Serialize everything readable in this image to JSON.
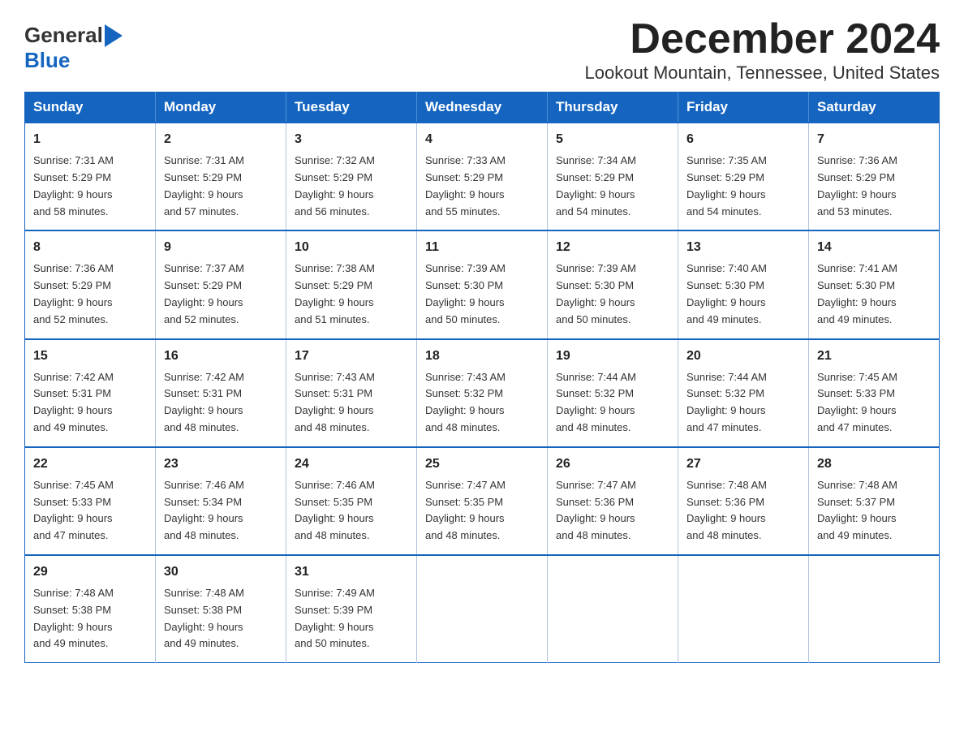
{
  "header": {
    "logo_general": "General",
    "logo_blue": "Blue",
    "title": "December 2024",
    "subtitle": "Lookout Mountain, Tennessee, United States"
  },
  "days_of_week": [
    "Sunday",
    "Monday",
    "Tuesday",
    "Wednesday",
    "Thursday",
    "Friday",
    "Saturday"
  ],
  "weeks": [
    [
      {
        "day": "1",
        "sunrise": "7:31 AM",
        "sunset": "5:29 PM",
        "daylight": "9 hours and 58 minutes."
      },
      {
        "day": "2",
        "sunrise": "7:31 AM",
        "sunset": "5:29 PM",
        "daylight": "9 hours and 57 minutes."
      },
      {
        "day": "3",
        "sunrise": "7:32 AM",
        "sunset": "5:29 PM",
        "daylight": "9 hours and 56 minutes."
      },
      {
        "day": "4",
        "sunrise": "7:33 AM",
        "sunset": "5:29 PM",
        "daylight": "9 hours and 55 minutes."
      },
      {
        "day": "5",
        "sunrise": "7:34 AM",
        "sunset": "5:29 PM",
        "daylight": "9 hours and 54 minutes."
      },
      {
        "day": "6",
        "sunrise": "7:35 AM",
        "sunset": "5:29 PM",
        "daylight": "9 hours and 54 minutes."
      },
      {
        "day": "7",
        "sunrise": "7:36 AM",
        "sunset": "5:29 PM",
        "daylight": "9 hours and 53 minutes."
      }
    ],
    [
      {
        "day": "8",
        "sunrise": "7:36 AM",
        "sunset": "5:29 PM",
        "daylight": "9 hours and 52 minutes."
      },
      {
        "day": "9",
        "sunrise": "7:37 AM",
        "sunset": "5:29 PM",
        "daylight": "9 hours and 52 minutes."
      },
      {
        "day": "10",
        "sunrise": "7:38 AM",
        "sunset": "5:29 PM",
        "daylight": "9 hours and 51 minutes."
      },
      {
        "day": "11",
        "sunrise": "7:39 AM",
        "sunset": "5:30 PM",
        "daylight": "9 hours and 50 minutes."
      },
      {
        "day": "12",
        "sunrise": "7:39 AM",
        "sunset": "5:30 PM",
        "daylight": "9 hours and 50 minutes."
      },
      {
        "day": "13",
        "sunrise": "7:40 AM",
        "sunset": "5:30 PM",
        "daylight": "9 hours and 49 minutes."
      },
      {
        "day": "14",
        "sunrise": "7:41 AM",
        "sunset": "5:30 PM",
        "daylight": "9 hours and 49 minutes."
      }
    ],
    [
      {
        "day": "15",
        "sunrise": "7:42 AM",
        "sunset": "5:31 PM",
        "daylight": "9 hours and 49 minutes."
      },
      {
        "day": "16",
        "sunrise": "7:42 AM",
        "sunset": "5:31 PM",
        "daylight": "9 hours and 48 minutes."
      },
      {
        "day": "17",
        "sunrise": "7:43 AM",
        "sunset": "5:31 PM",
        "daylight": "9 hours and 48 minutes."
      },
      {
        "day": "18",
        "sunrise": "7:43 AM",
        "sunset": "5:32 PM",
        "daylight": "9 hours and 48 minutes."
      },
      {
        "day": "19",
        "sunrise": "7:44 AM",
        "sunset": "5:32 PM",
        "daylight": "9 hours and 48 minutes."
      },
      {
        "day": "20",
        "sunrise": "7:44 AM",
        "sunset": "5:32 PM",
        "daylight": "9 hours and 47 minutes."
      },
      {
        "day": "21",
        "sunrise": "7:45 AM",
        "sunset": "5:33 PM",
        "daylight": "9 hours and 47 minutes."
      }
    ],
    [
      {
        "day": "22",
        "sunrise": "7:45 AM",
        "sunset": "5:33 PM",
        "daylight": "9 hours and 47 minutes."
      },
      {
        "day": "23",
        "sunrise": "7:46 AM",
        "sunset": "5:34 PM",
        "daylight": "9 hours and 48 minutes."
      },
      {
        "day": "24",
        "sunrise": "7:46 AM",
        "sunset": "5:35 PM",
        "daylight": "9 hours and 48 minutes."
      },
      {
        "day": "25",
        "sunrise": "7:47 AM",
        "sunset": "5:35 PM",
        "daylight": "9 hours and 48 minutes."
      },
      {
        "day": "26",
        "sunrise": "7:47 AM",
        "sunset": "5:36 PM",
        "daylight": "9 hours and 48 minutes."
      },
      {
        "day": "27",
        "sunrise": "7:48 AM",
        "sunset": "5:36 PM",
        "daylight": "9 hours and 48 minutes."
      },
      {
        "day": "28",
        "sunrise": "7:48 AM",
        "sunset": "5:37 PM",
        "daylight": "9 hours and 49 minutes."
      }
    ],
    [
      {
        "day": "29",
        "sunrise": "7:48 AM",
        "sunset": "5:38 PM",
        "daylight": "9 hours and 49 minutes."
      },
      {
        "day": "30",
        "sunrise": "7:48 AM",
        "sunset": "5:38 PM",
        "daylight": "9 hours and 49 minutes."
      },
      {
        "day": "31",
        "sunrise": "7:49 AM",
        "sunset": "5:39 PM",
        "daylight": "9 hours and 50 minutes."
      },
      null,
      null,
      null,
      null
    ]
  ],
  "labels": {
    "sunrise": "Sunrise:",
    "sunset": "Sunset:",
    "daylight": "Daylight:"
  }
}
